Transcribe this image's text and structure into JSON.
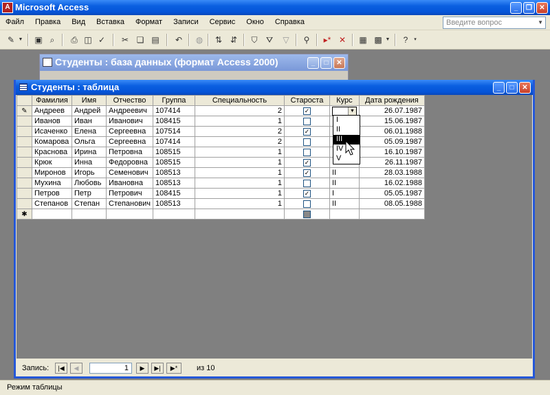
{
  "app": {
    "title": "Microsoft Access"
  },
  "menu": [
    "Файл",
    "Правка",
    "Вид",
    "Вставка",
    "Формат",
    "Записи",
    "Сервис",
    "Окно",
    "Справка"
  ],
  "ask": {
    "placeholder": "Введите вопрос"
  },
  "bg_window": {
    "title": "Студенты : база данных (формат Access 2000)"
  },
  "table_window": {
    "title": "Студенты : таблица"
  },
  "columns": [
    "Фамилия",
    "Имя",
    "Отчество",
    "Группа",
    "Специальность",
    "Староста",
    "Курс",
    "Дата рождения"
  ],
  "rows": [
    {
      "last": "Андреев",
      "first": "Андрей",
      "middle": "Андреевич",
      "group": "107414",
      "spec": "2",
      "head": true,
      "course": "",
      "dob": "26.07.1987"
    },
    {
      "last": "Иванов",
      "first": "Иван",
      "middle": "Иванович",
      "group": "108415",
      "spec": "1",
      "head": false,
      "course": "",
      "dob": "15.06.1987"
    },
    {
      "last": "Исаченко",
      "first": "Елена",
      "middle": "Сергеевна",
      "group": "107514",
      "spec": "2",
      "head": true,
      "course": "",
      "dob": "06.01.1988"
    },
    {
      "last": "Комарова",
      "first": "Ольга",
      "middle": "Сергеевна",
      "group": "107414",
      "spec": "2",
      "head": false,
      "course": "",
      "dob": "05.09.1987"
    },
    {
      "last": "Краснова",
      "first": "Ирина",
      "middle": "Петровна",
      "group": "108515",
      "spec": "1",
      "head": false,
      "course": "",
      "dob": "16.10.1987"
    },
    {
      "last": "Крюк",
      "first": "Инна",
      "middle": "Федоровна",
      "group": "108515",
      "spec": "1",
      "head": true,
      "course": "",
      "dob": "26.11.1987"
    },
    {
      "last": "Миронов",
      "first": "Игорь",
      "middle": "Семенович",
      "group": "108513",
      "spec": "1",
      "head": true,
      "course": "II",
      "dob": "28.03.1988"
    },
    {
      "last": "Мухина",
      "first": "Любовь",
      "middle": "Ивановна",
      "group": "108513",
      "spec": "1",
      "head": false,
      "course": "II",
      "dob": "16.02.1988"
    },
    {
      "last": "Петров",
      "first": "Петр",
      "middle": "Петрович",
      "group": "108415",
      "spec": "1",
      "head": true,
      "course": "I",
      "dob": "05.05.1987"
    },
    {
      "last": "Степанов",
      "first": "Степан",
      "middle": "Степанович",
      "group": "108513",
      "spec": "1",
      "head": false,
      "course": "II",
      "dob": "08.05.1988"
    }
  ],
  "course_options": [
    "I",
    "II",
    "III",
    "IV",
    "V"
  ],
  "course_selected": "III",
  "nav": {
    "label": "Запись:",
    "current": "1",
    "of_label": "из",
    "total": "10"
  },
  "status": {
    "text": "Режим таблицы"
  }
}
